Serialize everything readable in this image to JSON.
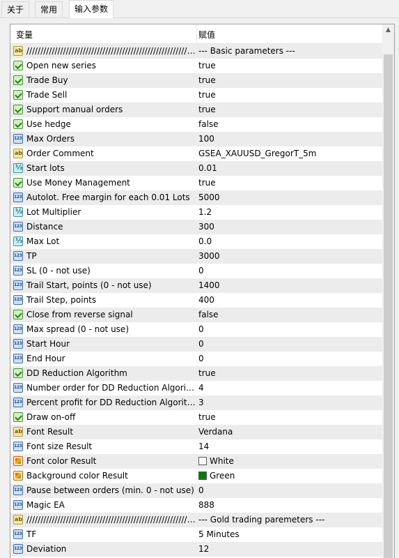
{
  "tabs": [
    {
      "label": "关于"
    },
    {
      "label": "常用"
    },
    {
      "label": "输入参数"
    }
  ],
  "header": {
    "variable": "变量",
    "value": "赋值"
  },
  "rows": [
    {
      "type": "string",
      "icon": "string-type-icon",
      "name": "////////////////////////////////////////////////////////////////",
      "value": "--- Basic parameters ---"
    },
    {
      "type": "bool",
      "icon": "bool-type-icon",
      "name": "Open new series",
      "value": "true"
    },
    {
      "type": "bool",
      "icon": "bool-type-icon",
      "name": "Trade Buy",
      "value": "true"
    },
    {
      "type": "bool",
      "icon": "bool-type-icon",
      "name": "Trade Sell",
      "value": "true"
    },
    {
      "type": "bool",
      "icon": "bool-type-icon",
      "name": "Support manual orders",
      "value": "true"
    },
    {
      "type": "bool",
      "icon": "bool-type-icon",
      "name": "Use hedge",
      "value": "false"
    },
    {
      "type": "int",
      "icon": "integer-type-icon",
      "name": "Max Orders",
      "value": "100"
    },
    {
      "type": "string",
      "icon": "string-type-icon",
      "name": "Order Comment",
      "value": "GSEA_XAUUSD_GregorT_5m"
    },
    {
      "type": "double",
      "icon": "double-type-icon",
      "name": "Start lots",
      "value": "0.01"
    },
    {
      "type": "bool",
      "icon": "bool-type-icon",
      "name": "Use Money Management",
      "value": "true"
    },
    {
      "type": "int",
      "icon": "integer-type-icon",
      "name": "Autolot. Free margin for each 0.01 Lots",
      "value": "5000"
    },
    {
      "type": "double",
      "icon": "double-type-icon",
      "name": "Lot Multiplier",
      "value": "1.2"
    },
    {
      "type": "int",
      "icon": "integer-type-icon",
      "name": "Distance",
      "value": "300"
    },
    {
      "type": "double",
      "icon": "double-type-icon",
      "name": "Max Lot",
      "value": "0.0"
    },
    {
      "type": "int",
      "icon": "integer-type-icon",
      "name": "TP",
      "value": "3000"
    },
    {
      "type": "int",
      "icon": "integer-type-icon",
      "name": "SL (0 - not use)",
      "value": "0"
    },
    {
      "type": "int",
      "icon": "integer-type-icon",
      "name": "Trail Start, points (0 - not use)",
      "value": "1400"
    },
    {
      "type": "int",
      "icon": "integer-type-icon",
      "name": "Trail Step, points",
      "value": "400"
    },
    {
      "type": "bool",
      "icon": "bool-type-icon",
      "name": "Close from reverse signal",
      "value": "false"
    },
    {
      "type": "int",
      "icon": "integer-type-icon",
      "name": "Max spread (0 - not use)",
      "value": "0"
    },
    {
      "type": "int",
      "icon": "integer-type-icon",
      "name": "Start Hour",
      "value": "0"
    },
    {
      "type": "int",
      "icon": "integer-type-icon",
      "name": "End Hour",
      "value": "0"
    },
    {
      "type": "bool",
      "icon": "bool-type-icon",
      "name": "DD Reduction Algorithm",
      "value": "true"
    },
    {
      "type": "int",
      "icon": "integer-type-icon",
      "name": "Number order for DD Reduction Algorithm",
      "value": "4"
    },
    {
      "type": "int",
      "icon": "integer-type-icon",
      "name": "Percent profit for DD Reduction Algorithm",
      "value": "3"
    },
    {
      "type": "bool",
      "icon": "bool-type-icon",
      "name": "Draw on-off",
      "value": "true"
    },
    {
      "type": "string",
      "icon": "string-type-icon",
      "name": "Font Result",
      "value": "Verdana"
    },
    {
      "type": "int",
      "icon": "integer-type-icon",
      "name": "Font size Result",
      "value": "14"
    },
    {
      "type": "color",
      "icon": "color-type-icon",
      "name": "Font color Result",
      "value": "White",
      "swatch": "#ffffff"
    },
    {
      "type": "color",
      "icon": "color-type-icon",
      "name": "Background color Result",
      "value": "Green",
      "swatch": "#008000"
    },
    {
      "type": "int",
      "icon": "integer-type-icon",
      "name": "Pause between orders (min. 0 - not use)",
      "value": "0"
    },
    {
      "type": "int",
      "icon": "integer-type-icon",
      "name": "Magic EA",
      "value": "888"
    },
    {
      "type": "string",
      "icon": "string-type-icon",
      "name": "////////////////////////////////////////////////////////////////",
      "value": "--- Gold trading paremeters ---"
    },
    {
      "type": "int",
      "icon": "integer-type-icon",
      "name": "TF",
      "value": "5 Minutes"
    },
    {
      "type": "int",
      "icon": "integer-type-icon",
      "name": "Deviation",
      "value": "12"
    }
  ]
}
